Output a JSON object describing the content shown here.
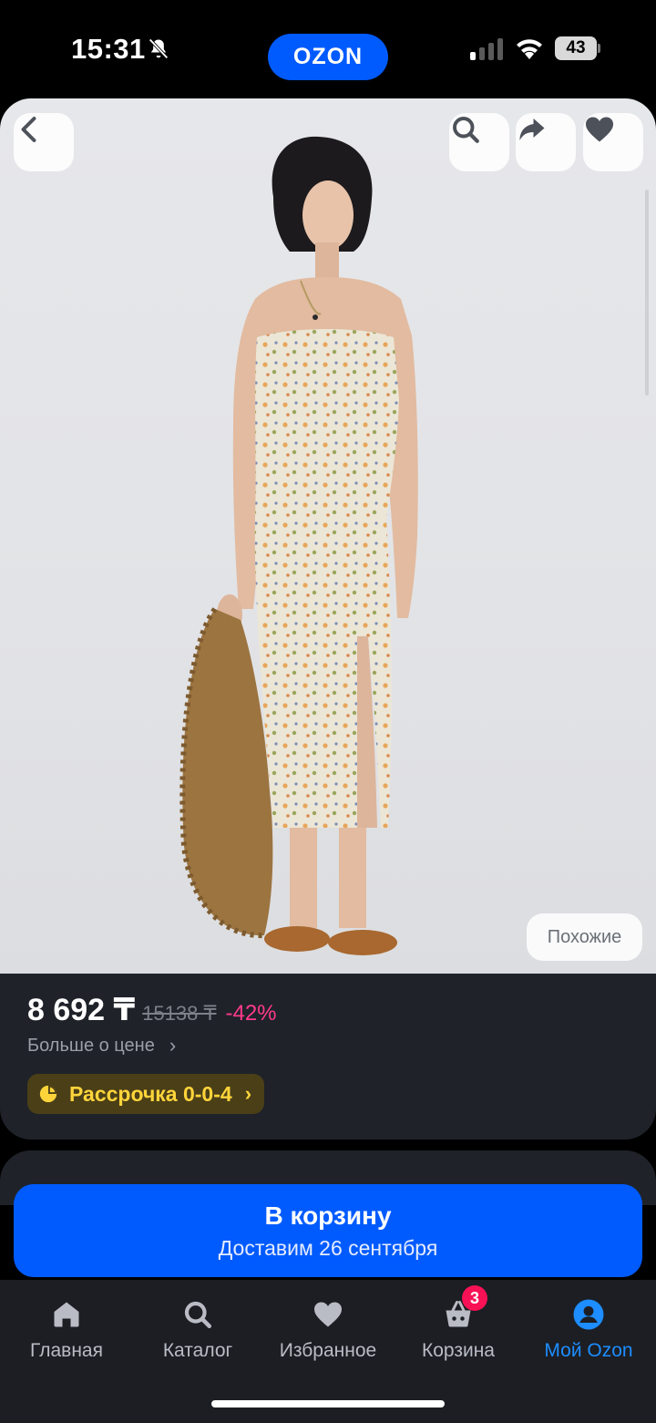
{
  "status_bar": {
    "time": "15:31",
    "app_logo": "OZON",
    "battery": "43",
    "icons": [
      "bell-off-icon",
      "signal-icon",
      "wifi-icon",
      "battery-icon"
    ]
  },
  "product": {
    "image_alt": "floral-slip-dress-photo",
    "similar_label": "Похожие",
    "price": "8 692 ₸",
    "old_price": "15138 ₸",
    "discount": "-42%",
    "price_more": "Больше о цене",
    "installment": "Рассрочка 0-0-4"
  },
  "top_actions": [
    "back-icon",
    "search-icon",
    "share-icon",
    "heart-icon"
  ],
  "cart_button": {
    "label": "В корзину",
    "delivery": "Доставим 26 сентября"
  },
  "tabbar": {
    "items": [
      {
        "label": "Главная",
        "icon": "home-icon"
      },
      {
        "label": "Каталог",
        "icon": "search-icon"
      },
      {
        "label": "Избранное",
        "icon": "heart-icon"
      },
      {
        "label": "Корзина",
        "icon": "basket-icon",
        "badge": "3"
      },
      {
        "label": "Мой Ozon",
        "icon": "profile-icon",
        "active": true
      }
    ]
  },
  "colors": {
    "brand_blue": "#005bff",
    "discount_pink": "#ff3a8c",
    "installment_yellow": "#ffd43b",
    "active_tab": "#1d8dff",
    "badge": "#f91155"
  }
}
